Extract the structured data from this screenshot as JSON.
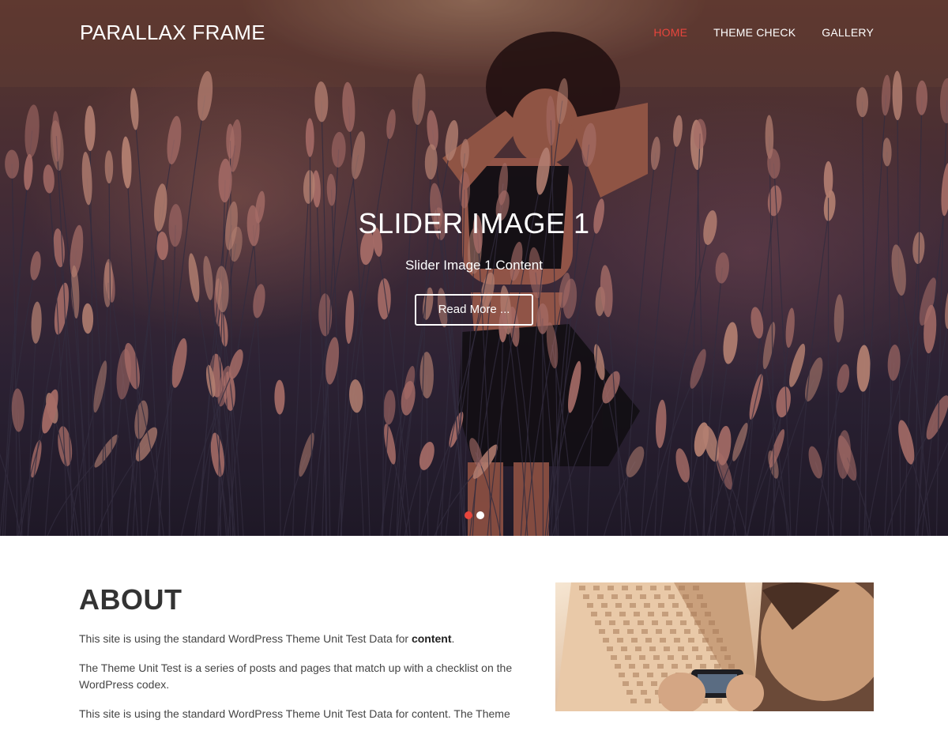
{
  "header": {
    "site_title": "PARALLAX FRAME",
    "nav": [
      {
        "label": "HOME",
        "active": true
      },
      {
        "label": "THEME CHECK",
        "active": false
      },
      {
        "label": "GALLERY",
        "active": false
      }
    ]
  },
  "slider": {
    "title": "SLIDER IMAGE 1",
    "content": "Slider Image 1 Content",
    "button_label": "Read More ...",
    "dots": [
      {
        "active": true
      },
      {
        "active": false
      }
    ]
  },
  "about": {
    "heading": "ABOUT",
    "p1_text": "This site is using the standard WordPress Theme Unit Test Data for ",
    "p1_bold": "content",
    "p1_end": ".",
    "p2": "The Theme Unit Test is a series of posts and pages that match up with a checklist on the WordPress codex.",
    "p3": "This site is using the standard WordPress Theme Unit Test Data for content. The Theme"
  },
  "colors": {
    "accent": "#e8453c",
    "nav_text": "#ffffff",
    "heading": "#333333"
  },
  "icons": {
    "slide_dot": "circle"
  }
}
